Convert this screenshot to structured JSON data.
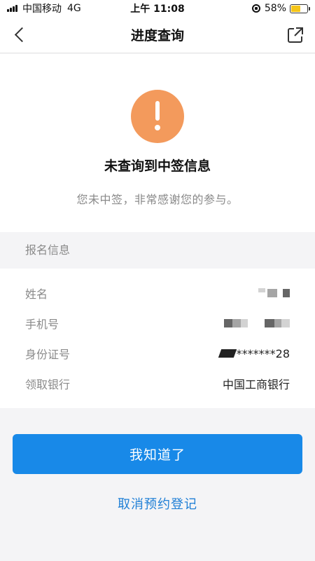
{
  "status_bar": {
    "carrier": "中国移动",
    "network": "4G",
    "time": "上午 11:08",
    "battery": "58%",
    "battery_level": 0.58
  },
  "nav": {
    "title": "进度查询",
    "back_icon": "chevron-left-icon",
    "share_icon": "external-link-icon"
  },
  "result": {
    "icon": "alert-icon",
    "icon_color": "#f39a5c",
    "title": "未查询到中签信息",
    "subtitle": "您未中签，非常感谢您的参与。"
  },
  "section": {
    "title": "报名信息"
  },
  "info": {
    "name_label": "姓名",
    "phone_label": "手机号",
    "id_label": "身份证号",
    "id_value": "*******28",
    "bank_label": "领取银行",
    "bank_value": "中国工商银行"
  },
  "actions": {
    "confirm_label": "我知道了",
    "confirm_color": "#1889e8",
    "cancel_label": "取消预约登记",
    "cancel_color": "#1f7fd6"
  }
}
